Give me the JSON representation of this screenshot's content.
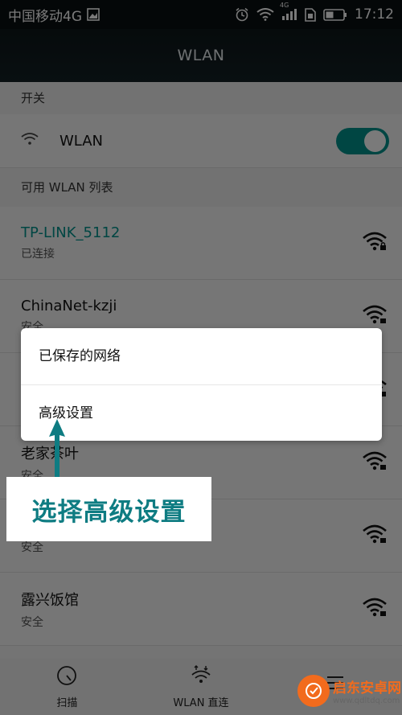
{
  "status_bar": {
    "carrier": "中国移动4G",
    "network_badge": "4G",
    "time": "17:12"
  },
  "app_bar": {
    "title": "WLAN"
  },
  "switch_section": {
    "header": "开关",
    "wlan_label": "WLAN",
    "toggle_on": true
  },
  "list_section": {
    "header": "可用 WLAN 列表",
    "networks": [
      {
        "name": "TP-LINK_5112",
        "status": "已连接",
        "connected": true
      },
      {
        "name": "ChinaNet-kzji",
        "status": "安全"
      },
      {
        "name": "",
        "status": ""
      },
      {
        "name": "老家茶叶",
        "status": "安全"
      },
      {
        "name": "",
        "status": "安全"
      },
      {
        "name": "露兴饭馆",
        "status": "安全"
      }
    ]
  },
  "popup_menu": {
    "items": [
      "已保存的网络",
      "高级设置"
    ]
  },
  "annotation": {
    "text": "选择高级设置"
  },
  "bottom_nav": {
    "items": [
      "扫描",
      "WLAN 直连",
      ""
    ]
  },
  "watermark": {
    "title": "启东安卓网",
    "url": "www.qdltdq.com"
  },
  "colors": {
    "accent": "#00928c",
    "annotation": "#0e7c82"
  },
  "icons": [
    "wifi-icon",
    "alarm-icon",
    "signal-icon",
    "battery-icon",
    "scan-icon",
    "wifi-direct-icon",
    "menu-icon"
  ]
}
